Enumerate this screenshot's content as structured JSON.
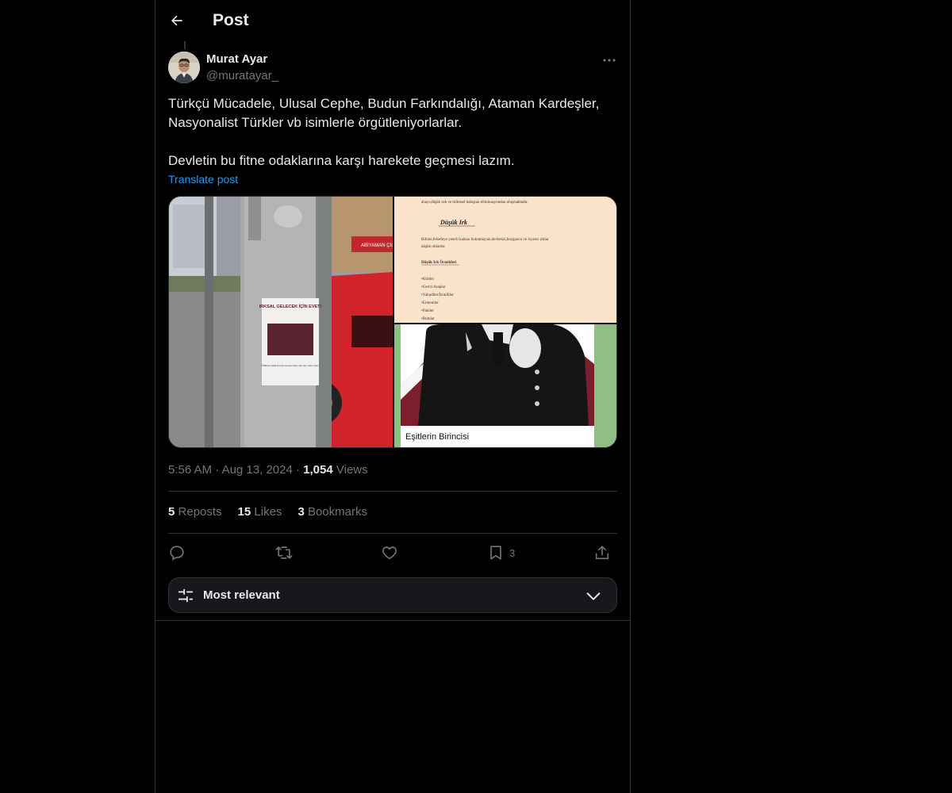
{
  "header": {
    "title": "Post"
  },
  "author": {
    "name": "Murat Ayar",
    "handle": "@muratayar_"
  },
  "post": {
    "text": "Türkçü Mücadele, Ulusal Cephe, Budun Farkındalığı, Ataman Kardeşler,\nNasyonalist Türkler vb isimlerle örgütleniyorlarlar.\n\nDevletin bu fitne odaklarına karşı harekete geçmesi lazım.",
    "translate_label": "Translate post"
  },
  "media": {
    "poster_text": "IRKSAL GELECEK İÇİN EVET!",
    "poster_quote": "\"Ölüleri bulmak için savaşacağız, her şey onlar için.\"",
    "doc_intro": "ahayı,düşük zek ve bilimsel bakıştan eliminasyondan oluşmaktadır.",
    "doc_heading": "Düşük Irk",
    "doc_paragraph1": "Bilime,felsefeye yeterli katkısı bulunmayan,devletsiz,bozguncu ve isyancı ırklar",
    "doc_paragraph2": "düşük ırklardır.",
    "doc_subheading": "Düşük Irk Örnekleri",
    "doc_list": [
      "•Kürtler",
      "•Gerici Araplar",
      "•Yahudiler/İsrailliler",
      "•Ermeniler",
      "•Pakiler",
      "•Rumlar"
    ],
    "caption": "Eşitlerin Birincisi"
  },
  "meta": {
    "time": "5:56 AM",
    "date": "Aug 13, 2024",
    "views_count": "1,054",
    "views_label": "Views"
  },
  "stats": {
    "reposts_count": "5",
    "reposts_label": "Reposts",
    "likes_count": "15",
    "likes_label": "Likes",
    "bookmarks_count": "3",
    "bookmarks_label": "Bookmarks"
  },
  "actions": {
    "bookmark_count": "3"
  },
  "sort": {
    "label": "Most relevant"
  },
  "colors": {
    "background": "#000000",
    "text": "#e7e9ea",
    "muted": "#71767b",
    "link": "#1d9bf0",
    "border": "#2f3336"
  },
  "icons": [
    "back-arrow-icon",
    "more-icon",
    "reply-icon",
    "repost-icon",
    "like-icon",
    "bookmark-icon",
    "share-icon",
    "sliders-icon",
    "chevron-down-icon"
  ]
}
